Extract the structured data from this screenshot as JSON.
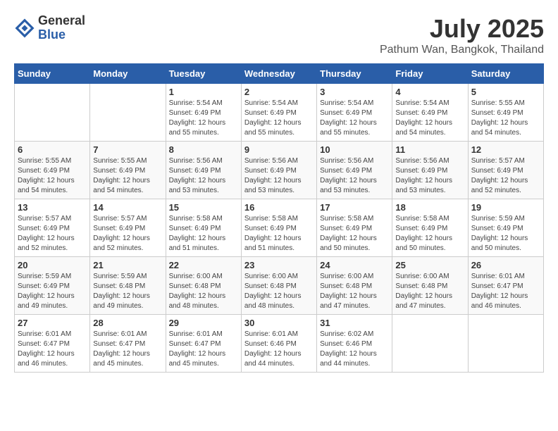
{
  "logo": {
    "general": "General",
    "blue": "Blue"
  },
  "title": {
    "month_year": "July 2025",
    "location": "Pathum Wan, Bangkok, Thailand"
  },
  "weekdays": [
    "Sunday",
    "Monday",
    "Tuesday",
    "Wednesday",
    "Thursday",
    "Friday",
    "Saturday"
  ],
  "weeks": [
    [
      {
        "day": "",
        "sunrise": "",
        "sunset": "",
        "daylight": ""
      },
      {
        "day": "",
        "sunrise": "",
        "sunset": "",
        "daylight": ""
      },
      {
        "day": "1",
        "sunrise": "Sunrise: 5:54 AM",
        "sunset": "Sunset: 6:49 PM",
        "daylight": "Daylight: 12 hours and 55 minutes."
      },
      {
        "day": "2",
        "sunrise": "Sunrise: 5:54 AM",
        "sunset": "Sunset: 6:49 PM",
        "daylight": "Daylight: 12 hours and 55 minutes."
      },
      {
        "day": "3",
        "sunrise": "Sunrise: 5:54 AM",
        "sunset": "Sunset: 6:49 PM",
        "daylight": "Daylight: 12 hours and 55 minutes."
      },
      {
        "day": "4",
        "sunrise": "Sunrise: 5:54 AM",
        "sunset": "Sunset: 6:49 PM",
        "daylight": "Daylight: 12 hours and 54 minutes."
      },
      {
        "day": "5",
        "sunrise": "Sunrise: 5:55 AM",
        "sunset": "Sunset: 6:49 PM",
        "daylight": "Daylight: 12 hours and 54 minutes."
      }
    ],
    [
      {
        "day": "6",
        "sunrise": "Sunrise: 5:55 AM",
        "sunset": "Sunset: 6:49 PM",
        "daylight": "Daylight: 12 hours and 54 minutes."
      },
      {
        "day": "7",
        "sunrise": "Sunrise: 5:55 AM",
        "sunset": "Sunset: 6:49 PM",
        "daylight": "Daylight: 12 hours and 54 minutes."
      },
      {
        "day": "8",
        "sunrise": "Sunrise: 5:56 AM",
        "sunset": "Sunset: 6:49 PM",
        "daylight": "Daylight: 12 hours and 53 minutes."
      },
      {
        "day": "9",
        "sunrise": "Sunrise: 5:56 AM",
        "sunset": "Sunset: 6:49 PM",
        "daylight": "Daylight: 12 hours and 53 minutes."
      },
      {
        "day": "10",
        "sunrise": "Sunrise: 5:56 AM",
        "sunset": "Sunset: 6:49 PM",
        "daylight": "Daylight: 12 hours and 53 minutes."
      },
      {
        "day": "11",
        "sunrise": "Sunrise: 5:56 AM",
        "sunset": "Sunset: 6:49 PM",
        "daylight": "Daylight: 12 hours and 53 minutes."
      },
      {
        "day": "12",
        "sunrise": "Sunrise: 5:57 AM",
        "sunset": "Sunset: 6:49 PM",
        "daylight": "Daylight: 12 hours and 52 minutes."
      }
    ],
    [
      {
        "day": "13",
        "sunrise": "Sunrise: 5:57 AM",
        "sunset": "Sunset: 6:49 PM",
        "daylight": "Daylight: 12 hours and 52 minutes."
      },
      {
        "day": "14",
        "sunrise": "Sunrise: 5:57 AM",
        "sunset": "Sunset: 6:49 PM",
        "daylight": "Daylight: 12 hours and 52 minutes."
      },
      {
        "day": "15",
        "sunrise": "Sunrise: 5:58 AM",
        "sunset": "Sunset: 6:49 PM",
        "daylight": "Daylight: 12 hours and 51 minutes."
      },
      {
        "day": "16",
        "sunrise": "Sunrise: 5:58 AM",
        "sunset": "Sunset: 6:49 PM",
        "daylight": "Daylight: 12 hours and 51 minutes."
      },
      {
        "day": "17",
        "sunrise": "Sunrise: 5:58 AM",
        "sunset": "Sunset: 6:49 PM",
        "daylight": "Daylight: 12 hours and 50 minutes."
      },
      {
        "day": "18",
        "sunrise": "Sunrise: 5:58 AM",
        "sunset": "Sunset: 6:49 PM",
        "daylight": "Daylight: 12 hours and 50 minutes."
      },
      {
        "day": "19",
        "sunrise": "Sunrise: 5:59 AM",
        "sunset": "Sunset: 6:49 PM",
        "daylight": "Daylight: 12 hours and 50 minutes."
      }
    ],
    [
      {
        "day": "20",
        "sunrise": "Sunrise: 5:59 AM",
        "sunset": "Sunset: 6:49 PM",
        "daylight": "Daylight: 12 hours and 49 minutes."
      },
      {
        "day": "21",
        "sunrise": "Sunrise: 5:59 AM",
        "sunset": "Sunset: 6:48 PM",
        "daylight": "Daylight: 12 hours and 49 minutes."
      },
      {
        "day": "22",
        "sunrise": "Sunrise: 6:00 AM",
        "sunset": "Sunset: 6:48 PM",
        "daylight": "Daylight: 12 hours and 48 minutes."
      },
      {
        "day": "23",
        "sunrise": "Sunrise: 6:00 AM",
        "sunset": "Sunset: 6:48 PM",
        "daylight": "Daylight: 12 hours and 48 minutes."
      },
      {
        "day": "24",
        "sunrise": "Sunrise: 6:00 AM",
        "sunset": "Sunset: 6:48 PM",
        "daylight": "Daylight: 12 hours and 47 minutes."
      },
      {
        "day": "25",
        "sunrise": "Sunrise: 6:00 AM",
        "sunset": "Sunset: 6:48 PM",
        "daylight": "Daylight: 12 hours and 47 minutes."
      },
      {
        "day": "26",
        "sunrise": "Sunrise: 6:01 AM",
        "sunset": "Sunset: 6:47 PM",
        "daylight": "Daylight: 12 hours and 46 minutes."
      }
    ],
    [
      {
        "day": "27",
        "sunrise": "Sunrise: 6:01 AM",
        "sunset": "Sunset: 6:47 PM",
        "daylight": "Daylight: 12 hours and 46 minutes."
      },
      {
        "day": "28",
        "sunrise": "Sunrise: 6:01 AM",
        "sunset": "Sunset: 6:47 PM",
        "daylight": "Daylight: 12 hours and 45 minutes."
      },
      {
        "day": "29",
        "sunrise": "Sunrise: 6:01 AM",
        "sunset": "Sunset: 6:47 PM",
        "daylight": "Daylight: 12 hours and 45 minutes."
      },
      {
        "day": "30",
        "sunrise": "Sunrise: 6:01 AM",
        "sunset": "Sunset: 6:46 PM",
        "daylight": "Daylight: 12 hours and 44 minutes."
      },
      {
        "day": "31",
        "sunrise": "Sunrise: 6:02 AM",
        "sunset": "Sunset: 6:46 PM",
        "daylight": "Daylight: 12 hours and 44 minutes."
      },
      {
        "day": "",
        "sunrise": "",
        "sunset": "",
        "daylight": ""
      },
      {
        "day": "",
        "sunrise": "",
        "sunset": "",
        "daylight": ""
      }
    ]
  ]
}
